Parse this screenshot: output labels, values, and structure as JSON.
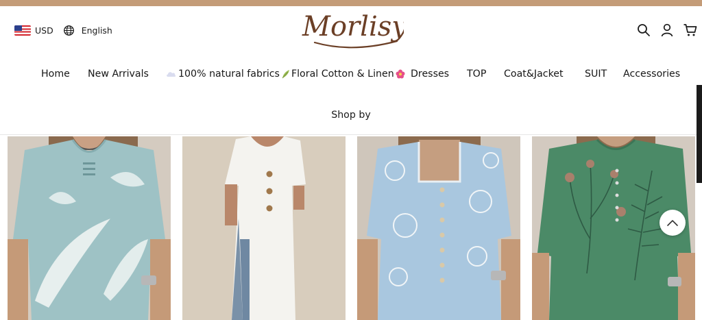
{
  "header": {
    "currency": "USD",
    "language": "English",
    "logo_text": "Morlisy"
  },
  "icons": [
    "flag-us-icon",
    "globe-icon",
    "search-icon",
    "account-icon",
    "cart-icon",
    "scroll-top-icon"
  ],
  "nav": {
    "items": [
      {
        "label": "Home"
      },
      {
        "label": "New Arrivals"
      },
      {
        "label": "100% natural fabrics",
        "label2": "Floral Cotton & Linen"
      },
      {
        "label": "Dresses"
      },
      {
        "label": "TOP"
      },
      {
        "label": "Coat&Jacket"
      },
      {
        "label": "SUIT"
      },
      {
        "label": "Accessories"
      }
    ],
    "shop_by": "Shop by"
  },
  "colors": {
    "top_bar": "#c49c78",
    "logo": "#6b3f26",
    "card_bg": "#d6cdc2"
  }
}
